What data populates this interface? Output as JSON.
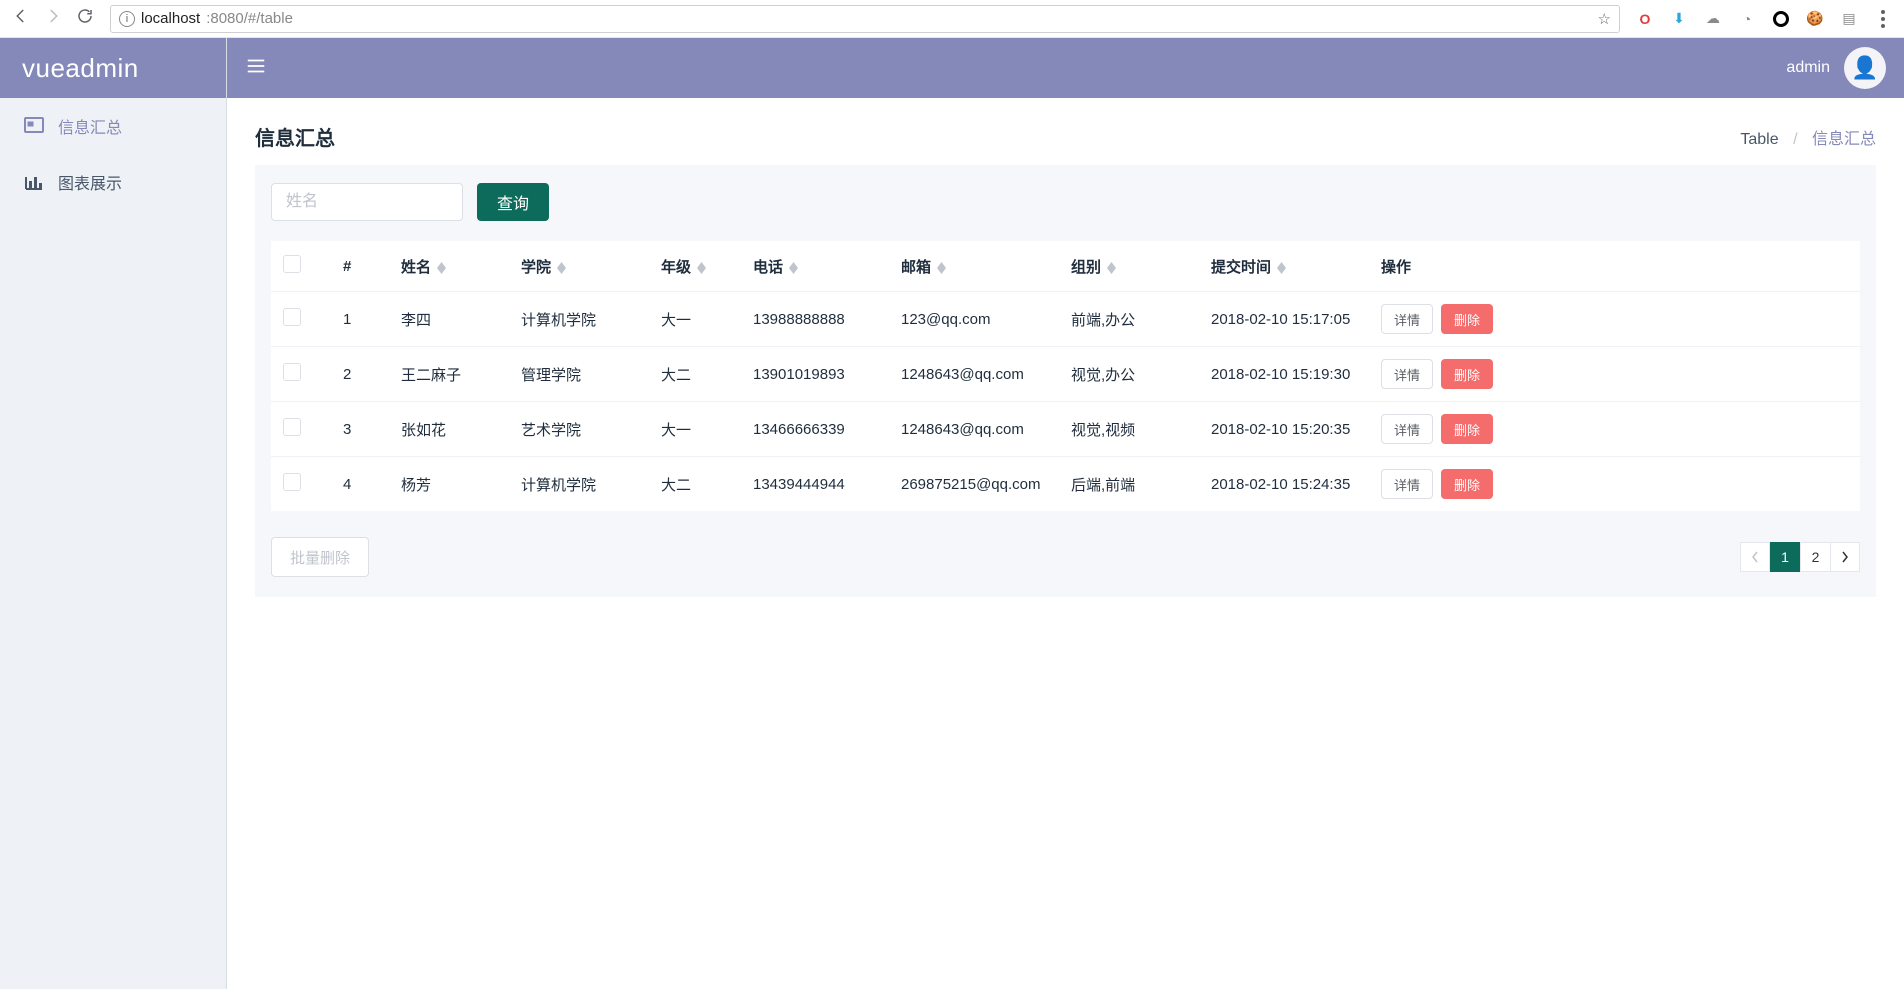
{
  "browser": {
    "url_host": "localhost",
    "url_rest": ":8080/#/table"
  },
  "brand": "vueadmin",
  "user": {
    "name": "admin"
  },
  "sidebar": {
    "items": [
      {
        "label": "信息汇总",
        "active": true
      },
      {
        "label": "图表展示",
        "active": false
      }
    ]
  },
  "page": {
    "title": "信息汇总",
    "breadcrumb": {
      "root": "Table",
      "current": "信息汇总"
    }
  },
  "filter": {
    "name_placeholder": "姓名",
    "search_label": "查询"
  },
  "table": {
    "headers": {
      "index": "#",
      "name": "姓名",
      "college": "学院",
      "grade": "年级",
      "phone": "电话",
      "email": "邮箱",
      "group": "组别",
      "time": "提交时间",
      "ops": "操作"
    },
    "rows": [
      {
        "index": "1",
        "name": "李四",
        "college": "计算机学院",
        "grade": "大一",
        "phone": "13988888888",
        "email": "123@qq.com",
        "group": "前端,办公",
        "time": "2018-02-10 15:17:05"
      },
      {
        "index": "2",
        "name": "王二麻子",
        "college": "管理学院",
        "grade": "大二",
        "phone": "13901019893",
        "email": "1248643@qq.com",
        "group": "视觉,办公",
        "time": "2018-02-10 15:19:30"
      },
      {
        "index": "3",
        "name": "张如花",
        "college": "艺术学院",
        "grade": "大一",
        "phone": "13466666339",
        "email": "1248643@qq.com",
        "group": "视觉,视频",
        "time": "2018-02-10 15:20:35"
      },
      {
        "index": "4",
        "name": "杨芳",
        "college": "计算机学院",
        "grade": "大二",
        "phone": "13439444944",
        "email": "269875215@qq.com",
        "group": "后端,前端",
        "time": "2018-02-10 15:24:35"
      }
    ],
    "row_buttons": {
      "detail": "详情",
      "delete": "删除"
    }
  },
  "footer": {
    "batch_delete": "批量删除",
    "pagination": {
      "pages": [
        "1",
        "2"
      ],
      "active": 1
    }
  }
}
